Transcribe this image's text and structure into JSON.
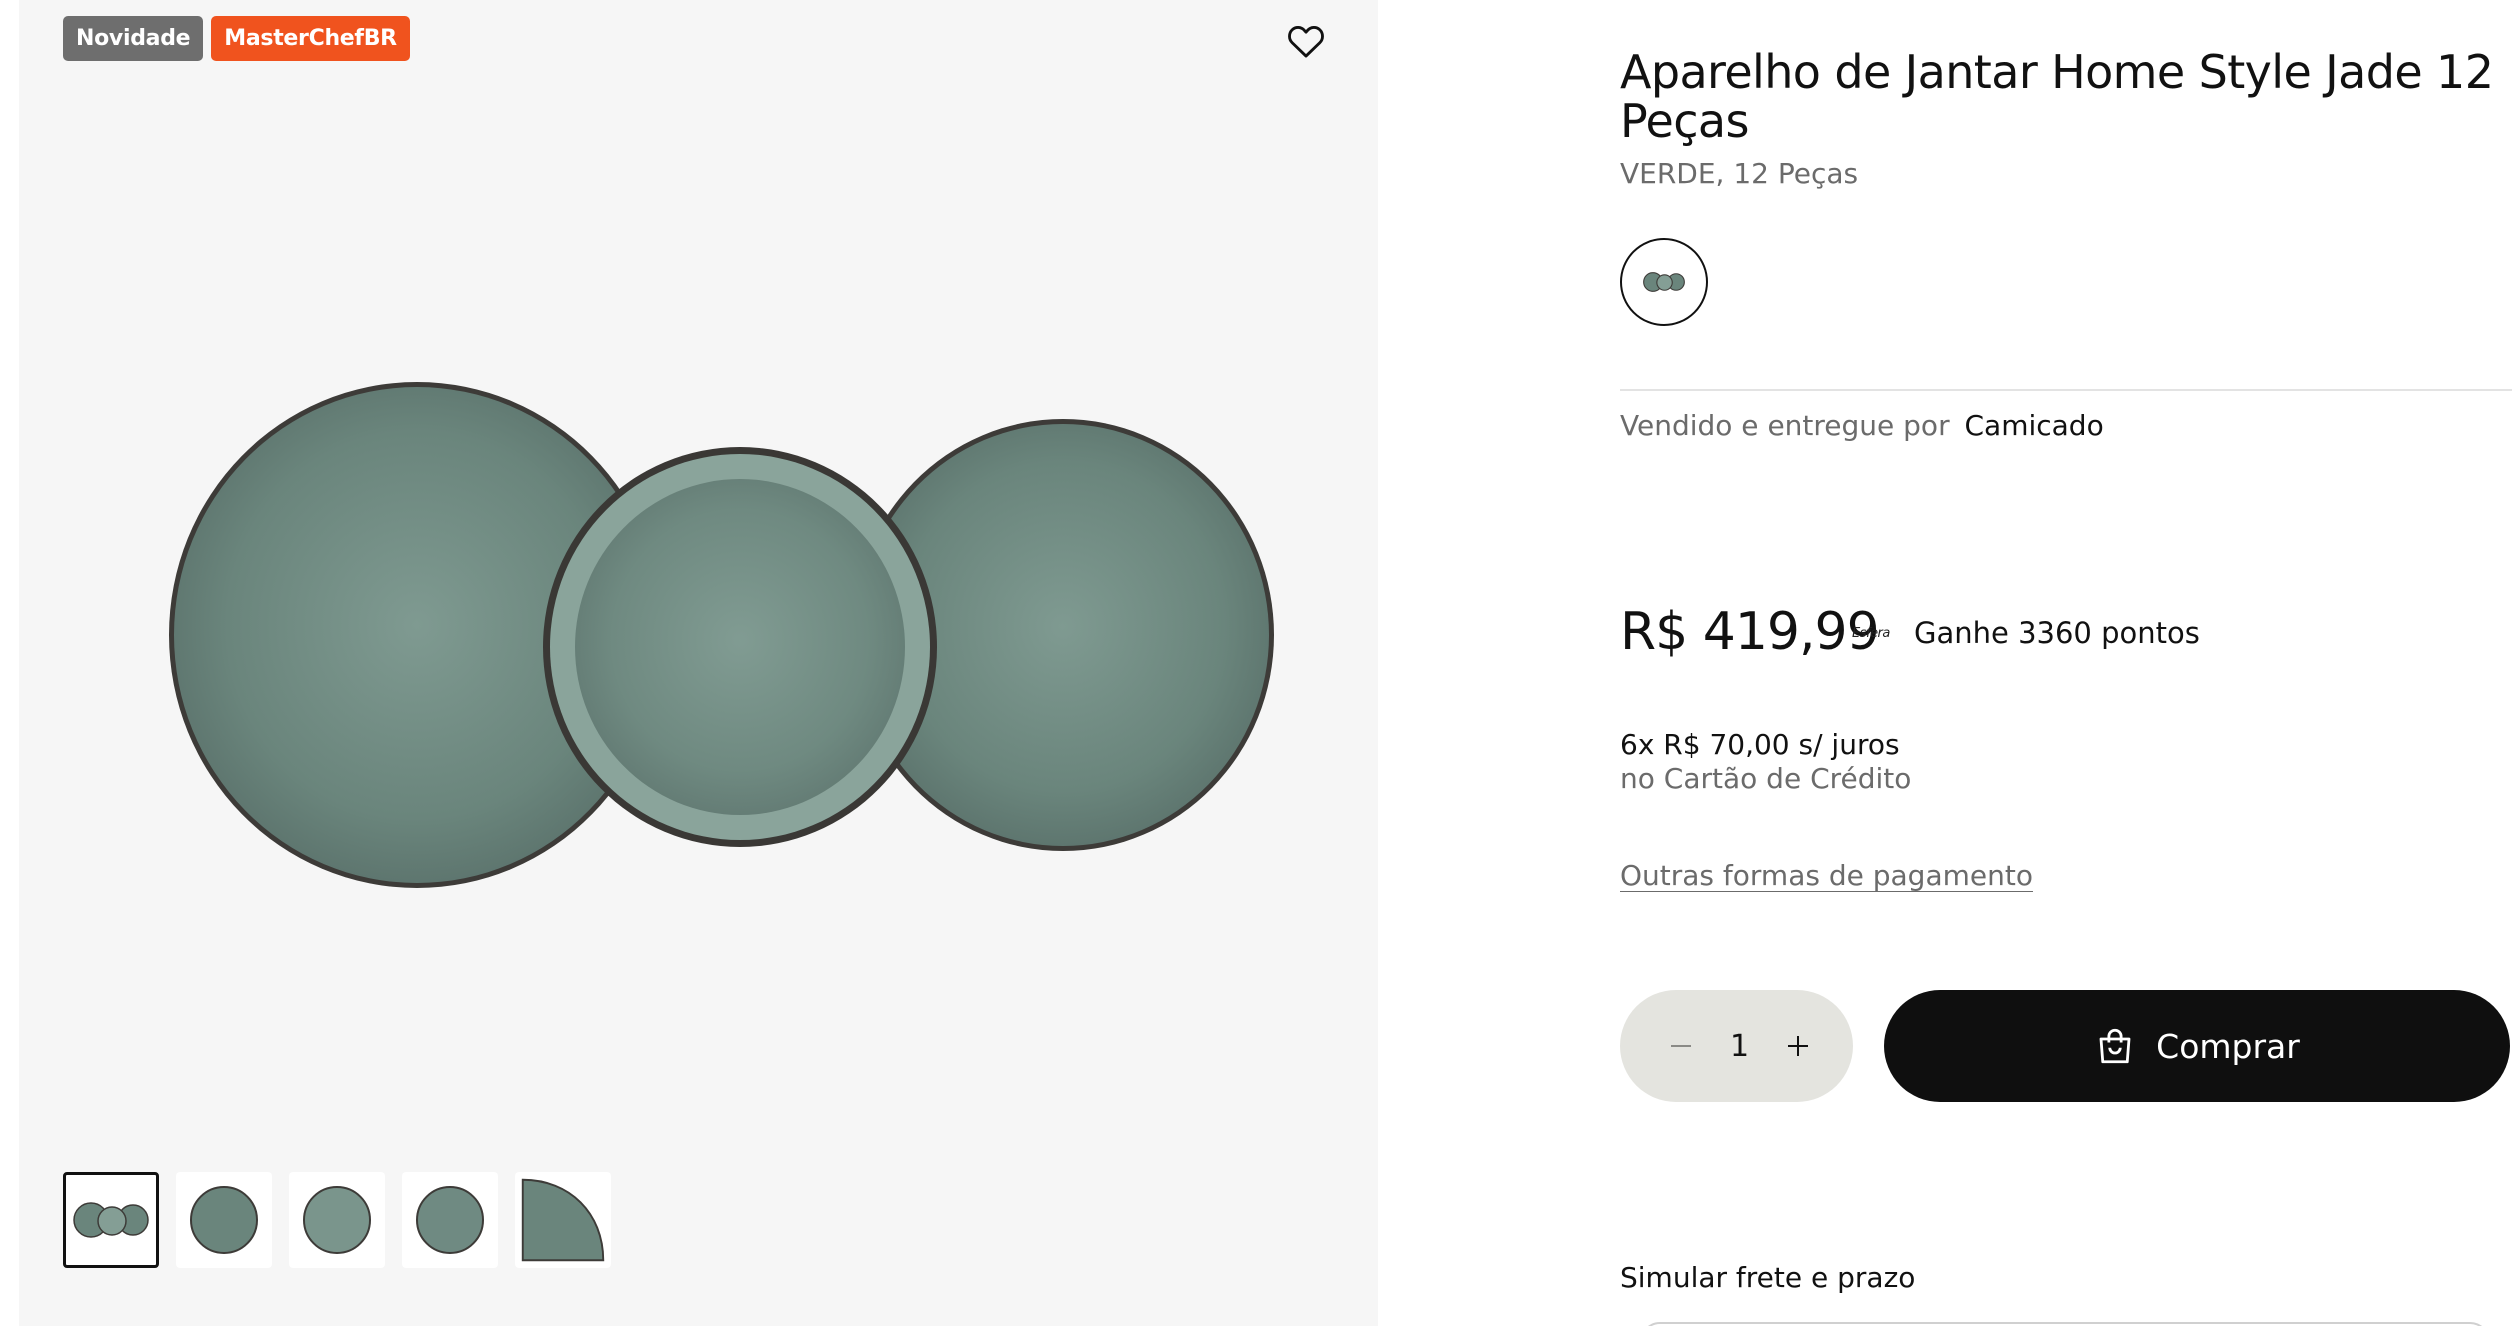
{
  "badges": {
    "new": "Novidade",
    "brand": "MasterChefBR"
  },
  "colors": {
    "badge_new": "#6e6e6e",
    "badge_brand": "#f0531e",
    "button": "#0f0f0f",
    "qty_bg": "#e4e4df",
    "plate": "#6f8a82"
  },
  "icons": {
    "favorite": "heart-outline-icon",
    "bag": "shopping-bag-icon",
    "minus": "minus-icon",
    "plus": "plus-icon"
  },
  "product": {
    "title": "Aparelho de Jantar Home Style Jade 12 Peças",
    "variant": "VERDE, 12 Peças"
  },
  "seller": {
    "label": "Vendido e entregue por",
    "name": "Camicado"
  },
  "pricing": {
    "price": "R$ 419,99",
    "points_brand": "Esfera",
    "points_text": "Ganhe 3360 pontos",
    "installments": "6x R$ 70,00 s/ juros",
    "installments_note": "no Cartão de Crédito",
    "other_payments": "Outras formas de pagamento"
  },
  "purchase": {
    "quantity": "1",
    "buy_label": "Comprar"
  },
  "shipping": {
    "label": "Simular frete e prazo"
  }
}
